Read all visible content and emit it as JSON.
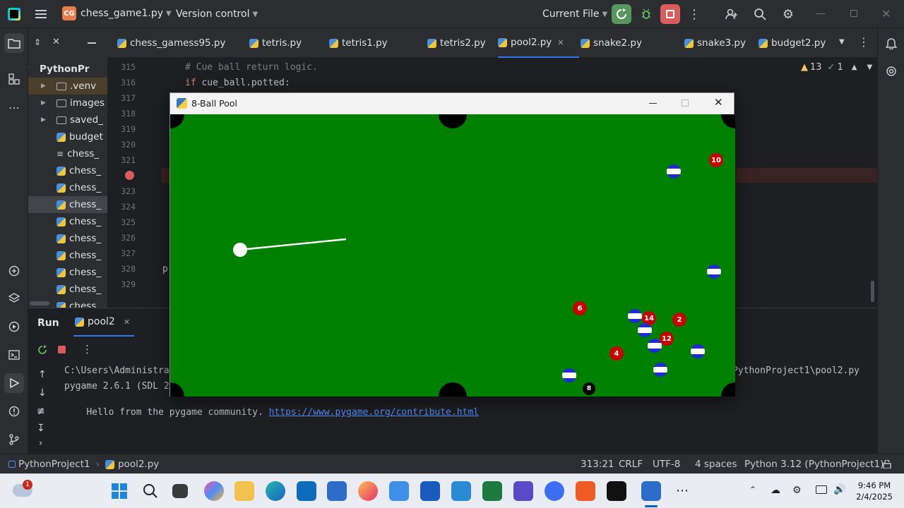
{
  "titlebar": {
    "app_badge": "CG",
    "project_name": "chess_game1.py",
    "version_control": "Version control",
    "run_config": "Current File"
  },
  "project_tree": [
    {
      "label": "PythonPr",
      "kind": "root"
    },
    {
      "label": ".venv",
      "kind": "folder"
    },
    {
      "label": "images",
      "kind": "folder"
    },
    {
      "label": "saved_",
      "kind": "folder"
    },
    {
      "label": "budget",
      "kind": "py"
    },
    {
      "label": "chess_",
      "kind": "text"
    },
    {
      "label": "chess_",
      "kind": "py"
    },
    {
      "label": "chess_",
      "kind": "py"
    },
    {
      "label": "chess_",
      "kind": "py",
      "selected": true
    },
    {
      "label": "chess_",
      "kind": "py"
    },
    {
      "label": "chess_",
      "kind": "py"
    },
    {
      "label": "chess_",
      "kind": "py"
    },
    {
      "label": "chess_",
      "kind": "py"
    },
    {
      "label": "chess_",
      "kind": "py"
    },
    {
      "label": "chess_",
      "kind": "py"
    }
  ],
  "tabs": [
    {
      "label": "chess_gamess95.py"
    },
    {
      "label": "tetris.py"
    },
    {
      "label": "tetris1.py"
    },
    {
      "label": "tetris2.py"
    },
    {
      "label": "pool2.py",
      "active": true
    },
    {
      "label": "snake2.py"
    },
    {
      "label": "snake3.py"
    },
    {
      "label": "budget2.py"
    }
  ],
  "editor": {
    "line_numbers": [
      "315",
      "316",
      "317",
      "318",
      "319",
      "320",
      "321",
      "322",
      "323",
      "324",
      "325",
      "326",
      "327",
      "328",
      "329"
    ],
    "code_line_1": "# Cue ball return logic.",
    "code_kw": "if",
    "code_line_2_rest": " cue_ball.potted:",
    "code_fragment": "p",
    "warnings": "13",
    "checks": "1"
  },
  "run_panel": {
    "title": "Run",
    "tab": "pool2",
    "console": {
      "line1_left": "C:\\Users\\Administra",
      "line1_right": "PythonProject1\\pool2.py",
      "line2": "pygame 2.6.1 (SDL 2",
      "line3_text": "Hello from the pygame community. ",
      "line3_link": "https://www.pygame.org/contribute.html"
    }
  },
  "statusbar": {
    "project": "PythonProject1",
    "file": "pool2.py",
    "position": "313:21",
    "line_sep": "CRLF",
    "encoding": "UTF-8",
    "indent": "4 spaces",
    "interpreter": "Python 3.12 (PythonProject1)"
  },
  "game_window": {
    "title": "8-Ball Pool",
    "table_color": "#008000",
    "balls": [
      {
        "type": "red",
        "label": "10"
      },
      {
        "type": "stripe",
        "label": ""
      },
      {
        "type": "stripe",
        "label": ""
      },
      {
        "type": "red",
        "label": "6"
      },
      {
        "type": "stripe",
        "label": ""
      },
      {
        "type": "red",
        "label": "14"
      },
      {
        "type": "red",
        "label": "2"
      },
      {
        "type": "stripe",
        "label": ""
      },
      {
        "type": "red",
        "label": "12"
      },
      {
        "type": "stripe",
        "label": ""
      },
      {
        "type": "red",
        "label": "4"
      },
      {
        "type": "stripe",
        "label": ""
      },
      {
        "type": "stripe",
        "label": ""
      },
      {
        "type": "stripe",
        "label": ""
      },
      {
        "type": "black",
        "label": "8"
      }
    ]
  },
  "taskbar": {
    "weather_badge": "1",
    "time": "9:46 PM",
    "date": "2/4/2025"
  }
}
